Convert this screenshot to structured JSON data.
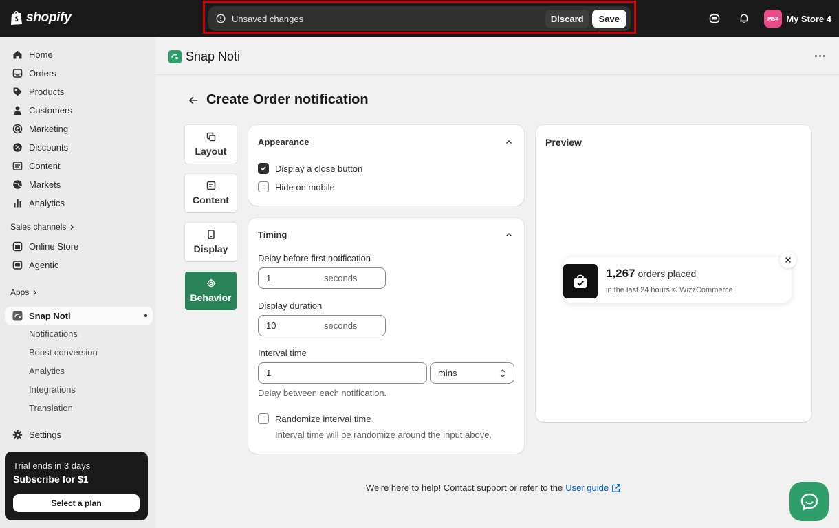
{
  "topbar": {
    "brand": "shopify",
    "unsaved_message": "Unsaved changes",
    "discard_label": "Discard",
    "save_label": "Save",
    "store_initials": "MS4",
    "store_name": "My Store 4"
  },
  "sidebar": {
    "items": [
      {
        "label": "Home",
        "icon": "home-icon"
      },
      {
        "label": "Orders",
        "icon": "orders-icon"
      },
      {
        "label": "Products",
        "icon": "tag-icon"
      },
      {
        "label": "Customers",
        "icon": "person-icon"
      },
      {
        "label": "Marketing",
        "icon": "target-icon"
      },
      {
        "label": "Discounts",
        "icon": "discount-icon"
      },
      {
        "label": "Content",
        "icon": "content-icon"
      },
      {
        "label": "Markets",
        "icon": "globe-icon"
      },
      {
        "label": "Analytics",
        "icon": "bar-chart-icon"
      }
    ],
    "sales_channels_label": "Sales channels",
    "channels": [
      {
        "label": "Online Store",
        "icon": "store-icon"
      },
      {
        "label": "Agentic",
        "icon": "agentic-icon"
      }
    ],
    "apps_label": "Apps",
    "app_name": "Snap Noti",
    "app_subitems": [
      "Notifications",
      "Boost conversion",
      "Analytics",
      "Integrations",
      "Translation"
    ],
    "settings_label": "Settings",
    "trial": {
      "line1": "Trial ends in 3 days",
      "line2": "Subscribe for $1",
      "button": "Select a plan"
    }
  },
  "app_header": {
    "name": "Snap Noti"
  },
  "page": {
    "title": "Create Order notification",
    "tabs": [
      {
        "label": "Layout",
        "icon": "layout-icon",
        "active": false
      },
      {
        "label": "Content",
        "icon": "content-edit-icon",
        "active": false
      },
      {
        "label": "Display",
        "icon": "mobile-icon",
        "active": false
      },
      {
        "label": "Behavior",
        "icon": "gear-icon",
        "active": true
      }
    ],
    "appearance": {
      "title": "Appearance",
      "close_button_label": "Display a close button",
      "close_button_checked": true,
      "hide_mobile_label": "Hide on mobile",
      "hide_mobile_checked": false
    },
    "timing": {
      "title": "Timing",
      "delay_label": "Delay before first notification",
      "delay_value": "1",
      "delay_suffix": "seconds",
      "duration_label": "Display duration",
      "duration_value": "10",
      "duration_suffix": "seconds",
      "interval_label": "Interval time",
      "interval_value": "1",
      "interval_unit": "mins",
      "interval_help": "Delay between each notification.",
      "randomize_label": "Randomize interval time",
      "randomize_checked": false,
      "randomize_help": "Interval time will be randomize around the input above."
    },
    "preview": {
      "title": "Preview",
      "count": "1,267",
      "text": "orders placed",
      "subtext": "in the last 24 hours © WizzCommerce"
    },
    "footer": {
      "text": "We're here to help! Contact support or refer to the",
      "link": "User guide"
    }
  },
  "colors": {
    "accent_green": "#29845a",
    "topbar_bg": "#1a1a1a",
    "store_avatar": "#ea4c89",
    "link_blue": "#005bd3",
    "highlight_red": "#d20000"
  }
}
